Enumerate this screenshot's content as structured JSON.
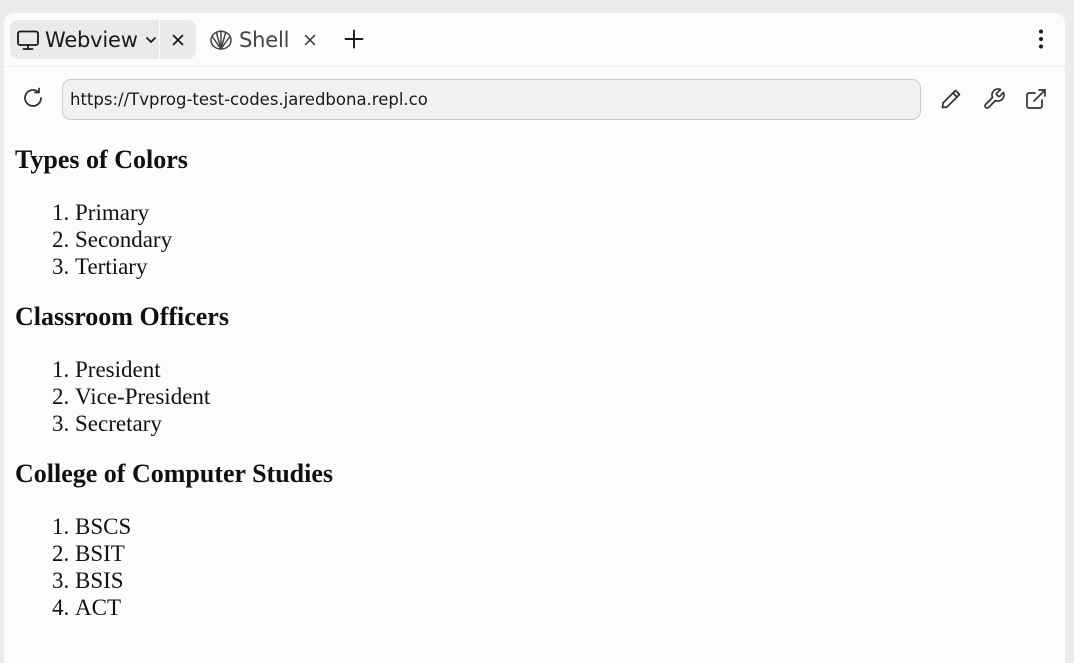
{
  "tabs": [
    {
      "label": "Webview",
      "icon": "monitor-icon",
      "active": true
    },
    {
      "label": "Shell",
      "icon": "shell-icon",
      "active": false
    }
  ],
  "urlbar": {
    "value": "https://Tvprog-test-codes.jaredbona.repl.co"
  },
  "page": {
    "sections": [
      {
        "heading": "Types of Colors",
        "items": [
          "Primary",
          "Secondary",
          "Tertiary"
        ]
      },
      {
        "heading": "Classroom Officers",
        "items": [
          "President",
          "Vice-President",
          "Secretary"
        ]
      },
      {
        "heading": "College of Computer Studies",
        "items": [
          "BSCS",
          "BSIT",
          "BSIS",
          "ACT"
        ]
      }
    ]
  },
  "colors": {
    "background": "#ebeced",
    "panel": "#fcfcfc",
    "active_tab": "#e9eaec",
    "url_field": "#f0f1f2",
    "text": "#1a1a1a"
  }
}
